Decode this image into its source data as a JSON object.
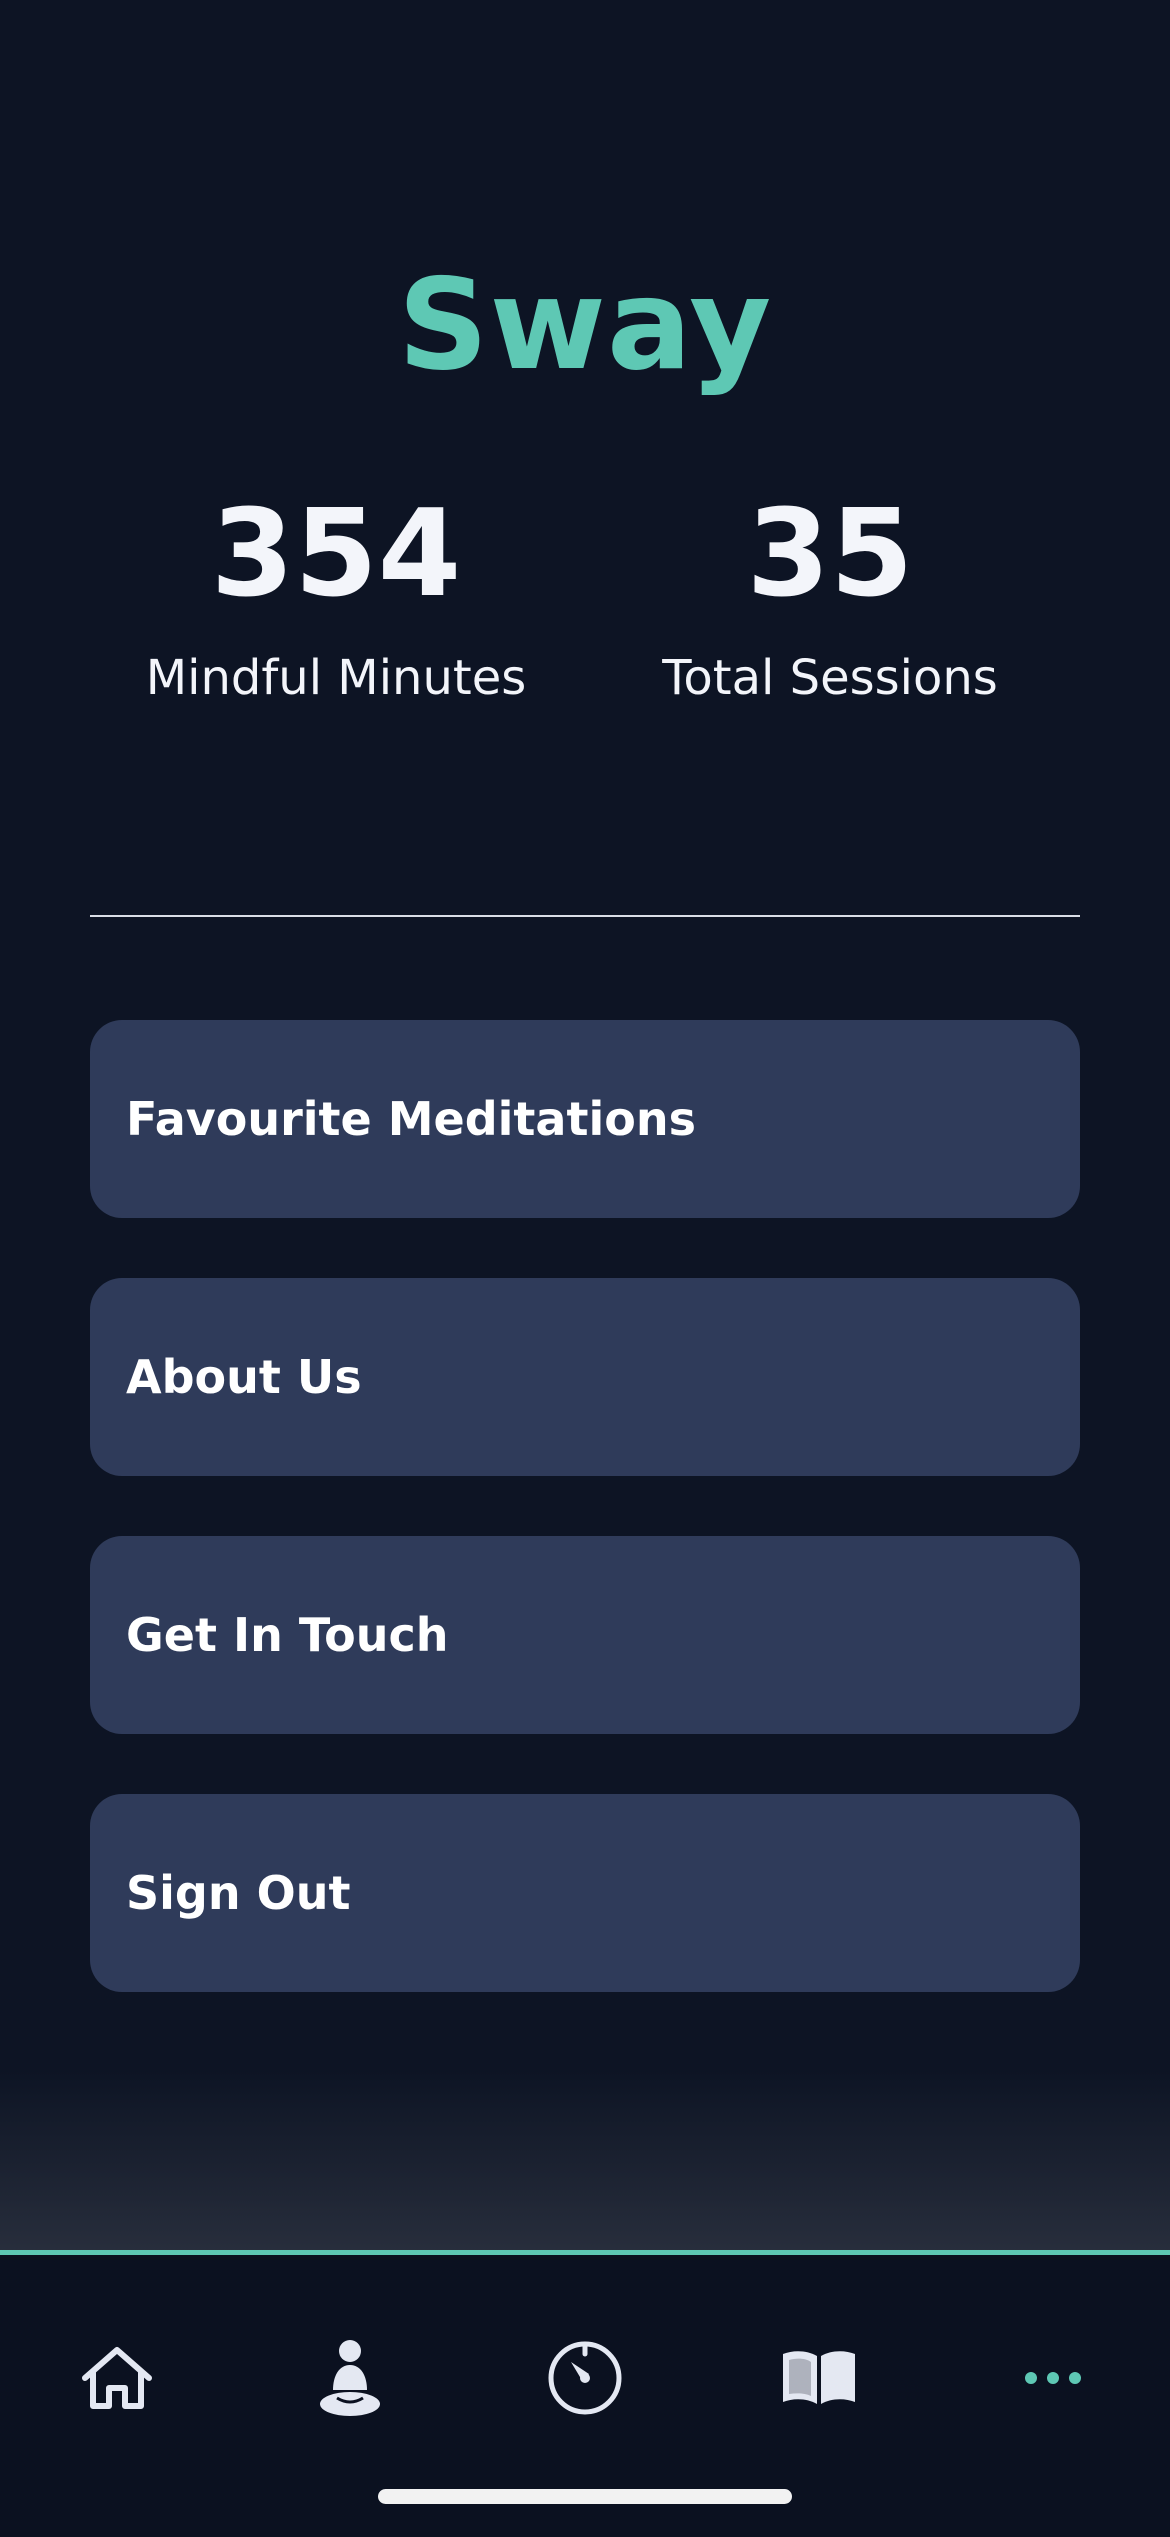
{
  "app": {
    "title": "Sway",
    "accent_color": "#5ec8b4",
    "background_color": "#0d1424",
    "card_color": "#2f3b5a"
  },
  "stats": [
    {
      "value": "354",
      "label": "Mindful Minutes"
    },
    {
      "value": "35",
      "label": "Total Sessions"
    }
  ],
  "menu": [
    {
      "label": "Favourite Meditations"
    },
    {
      "label": "About Us"
    },
    {
      "label": "Get In Touch"
    },
    {
      "label": "Sign Out"
    }
  ],
  "tab_bar": {
    "items": [
      {
        "icon": "home-icon",
        "active": false
      },
      {
        "icon": "meditation-icon",
        "active": false
      },
      {
        "icon": "timer-icon",
        "active": false
      },
      {
        "icon": "book-icon",
        "active": false
      },
      {
        "icon": "more-icon",
        "active": true
      }
    ]
  }
}
